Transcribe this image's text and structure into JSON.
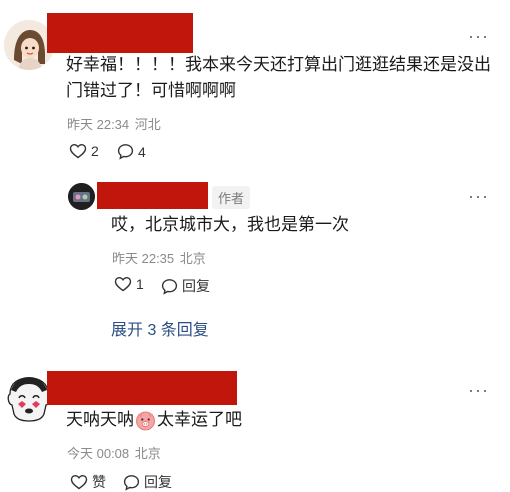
{
  "comments": [
    {
      "content": "好幸福！！！！我本来今天还打算出门逛逛结果还是没出门错过了！可惜啊啊啊",
      "time": "昨天 22:34",
      "location": "河北",
      "likes": "2",
      "replies_count": "4",
      "replies": [
        {
          "author_tag": "作者",
          "content": "哎，北京城市大，我也是第一次",
          "time": "昨天 22:35",
          "location": "北京",
          "likes": "1",
          "reply_label": "回复"
        }
      ],
      "expand_label": "展开 3 条回复"
    },
    {
      "content_before": "天呐天呐",
      "content_after": "太幸运了吧",
      "time": "今天 00:08",
      "location": "北京",
      "like_label": "赞",
      "reply_label": "回复"
    }
  ],
  "more_glyph": "···",
  "colors": {
    "redaction": "#c0160c",
    "link": "#2b4f83",
    "meta": "#8a8a8a"
  }
}
